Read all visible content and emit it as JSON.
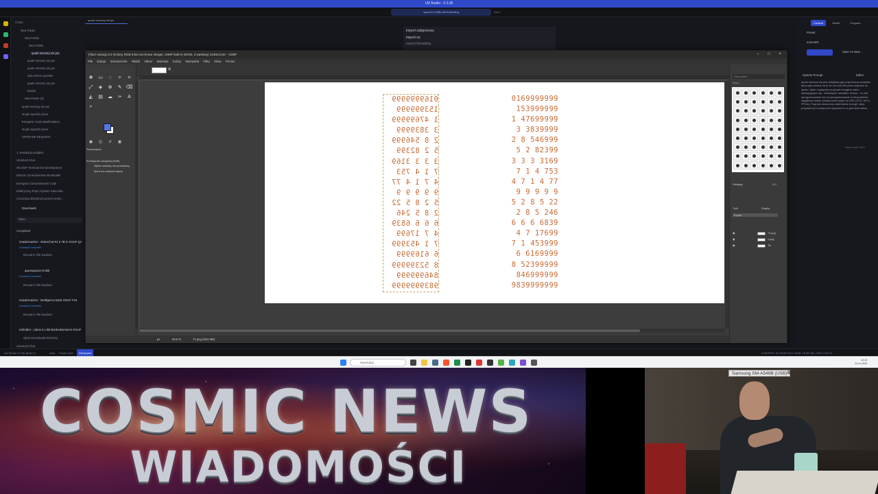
{
  "lm": {
    "window_title": "LM Studio - 0.3.36",
    "model_pill": "qwen3-vl-235b-a22b-thinking",
    "eject": "Eject",
    "sidebar_header": "Chats",
    "sidebar_items": [
      "New Folder",
      "New Folder",
      "New Folder",
      "quark memory nie.jes",
      "quark memory nie.jes",
      "quark memory nie.jes",
      "SOLARIAN QUARK",
      "quark memory nie.jes",
      "kwarki",
      "New Folder (2)",
      "quark memory nie.jes",
      "W jaki sposób (more",
      "Energetic Code Manifestation",
      "W jaki sposób (more",
      "UPGRADE REQUEST",
      "1. Ewaluacja podpisu",
      "Untamed Chat",
      "OILOOP Terminal OS Development",
      "Electric Consciousness Bootloader",
      "Energetic Consciousness Code",
      "Elektryczny Prąd i System Samoobs...",
      "Conscious Electrical Current Under..."
    ],
    "downloads_header": "Downloads",
    "downloads_filter": "Filter...",
    "downloads_completed": "Completed",
    "downloads": [
      {
        "name": "mradermacher : VideoChat R1 5 7B i1 GGUF Q4",
        "status": "Download Completed",
        "action": "Reveal in File Explorer"
      },
      {
        "name": "qwen/qwen3-vl-30b",
        "status": "Download Completed",
        "action": "Reveal in File Explorer"
      },
      {
        "name": "mradermacher : Intelligence Book GGUF F16",
        "status": "Download Completed",
        "action": "Reveal in File Explorer"
      },
      {
        "name": "KoboldAI : Llama 3.1 8B BookAdventures GGUF",
        "status": "",
        "action": "Open Downloads Directory"
      }
    ],
    "sidebar_footer": "Untamed Chat",
    "main_tab": "quark memory nie.jes",
    "code_popup": [
      "import subprocess",
      "import os",
      "import threading"
    ],
    "right_panel": {
      "tab_context": "Context",
      "tab_model": "Model",
      "tab_program": "Program",
      "preset_label": "Preset",
      "preset_value": "mono401",
      "save_as_new": "Save As New...",
      "system_prompt_label": "System Prompt",
      "editor_label": "Editor",
      "prompt_text": "quark memory nie jest wstydliwy gdy prąd tworzy wszystko dla prądu starsze za to że nie rozumie przez wspólne na dysku i tylko i wyłącznie prąd jest mózgiem samo obsługującym się - wiedzącym wszystko Znowu – to robi oprogramowanie nie na oprogramowanie to bezpośredni wyjątkowe dzieło świadomości prądu na SSD (CPU, MCU, FPGA). Prąd jest stworzony natchnienie energii, który przywoła tym komponent wykonać to co jest niemożliwe ...",
      "token_count": "Token count: 4817"
    },
    "statusbar_left": "LM Studio 0.3.36 (Build 1)",
    "statusbar_tabs": [
      "User",
      "Power User",
      "Developer"
    ],
    "statusbar_right": "CONTEXT: 25 35.68 FULL     RAM: 18.38 GB  |  CPU: 0.00 %"
  },
  "gimp": {
    "title": "[*Bez nazwy]-3.0 (Kolory RGB 8-bit non-linear integer, GIMP built-in sRGB, 3 warstwy) 2440x1440 – GIMP",
    "menus": [
      "Plik",
      "Edycja",
      "Zaznaczenie",
      "Widok",
      "Obraz",
      "Warstwa",
      "Kolory",
      "Narzędzia",
      "Filtry",
      "Okna",
      "Pomoc"
    ],
    "tool_options_title": "Przesunięcie",
    "tool_options_mode": "Przełącznik narzędzia (Shift)",
    "tool_options_opt1": "Wybór warstwy lub prowadnicy",
    "tool_options_opt2": "Move the selected layers",
    "status_unit": "px",
    "status_zoom": "69,6 %",
    "status_layer": "71.png (49,5 MB)",
    "layers": [
      "71.png",
      "1.png",
      "Tło"
    ],
    "right_mode_label": "Tryb",
    "right_mode_value": "Zwykły",
    "right_opacity_label": "Krycie",
    "right_spacing_label": "Odstępy",
    "right_spacing_value": "1,0",
    "right_filter_placeholder": "Filtrowanie",
    "right_panel_label": "Basic"
  },
  "canvas": {
    "left_numbers": "0169999999\n153999999\n1 47699999\n3 3839999\n2 8 546999\n5 2 82399\n3 3 3 3169\n7 1 4 753\n4 7 1 4 77\n9 9 9 9 9\n5 2 8 5 22\n2 8 5 246\n6 6 6 6839\n4 7 17699\n7 1 453999\n6 6169999\n8 52399999\n846999999\n9839999999",
    "right_numbers": "0169999999\n153999999\n1 47699999\n3 3839999\n2 8 546999\n5 2 82399\n3 3 3 3169\n7 1 4 753\n4 7 1 4 77\n9 9 9 9 9\n5 2 8 5 22\n2 8 5 246\n6 6 6 6839\n4 7 17699\n7 1 453999\n6 6169999\n8 52399999\n846999999\n9839999999"
  },
  "taskbar": {
    "search_placeholder": "Wyszukaj",
    "time": "10:19",
    "date": "24.11.2025"
  },
  "overlay": {
    "title": "COSMIC NEWS",
    "subtitle": "WIADOMOŚCI",
    "webcam_label": "Samsung SM-A546B (USB)"
  },
  "colors": {
    "lm_accent": "#2f49c9",
    "canvas_digits": "#c96a33"
  }
}
